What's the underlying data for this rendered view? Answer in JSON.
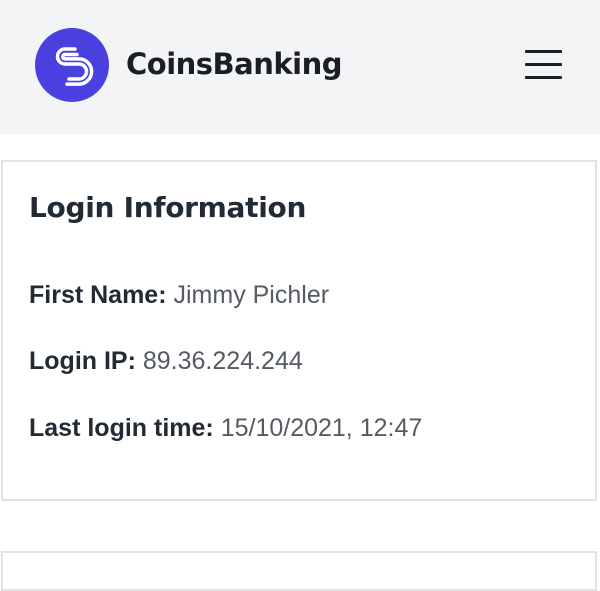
{
  "header": {
    "brand_name": "CoinsBanking",
    "logo_icon": "coinsbanking-logo-icon",
    "menu_icon": "hamburger-menu-icon",
    "accent_color": "#4a40e0"
  },
  "login_info": {
    "title": "Login Information",
    "first_name_label": "First Name:",
    "first_name_value": "Jimmy Pichler",
    "login_ip_label": "Login IP:",
    "login_ip_value": "89.36.224.244",
    "last_login_label": "Last login time:",
    "last_login_value": "15/10/2021, 12:47"
  }
}
